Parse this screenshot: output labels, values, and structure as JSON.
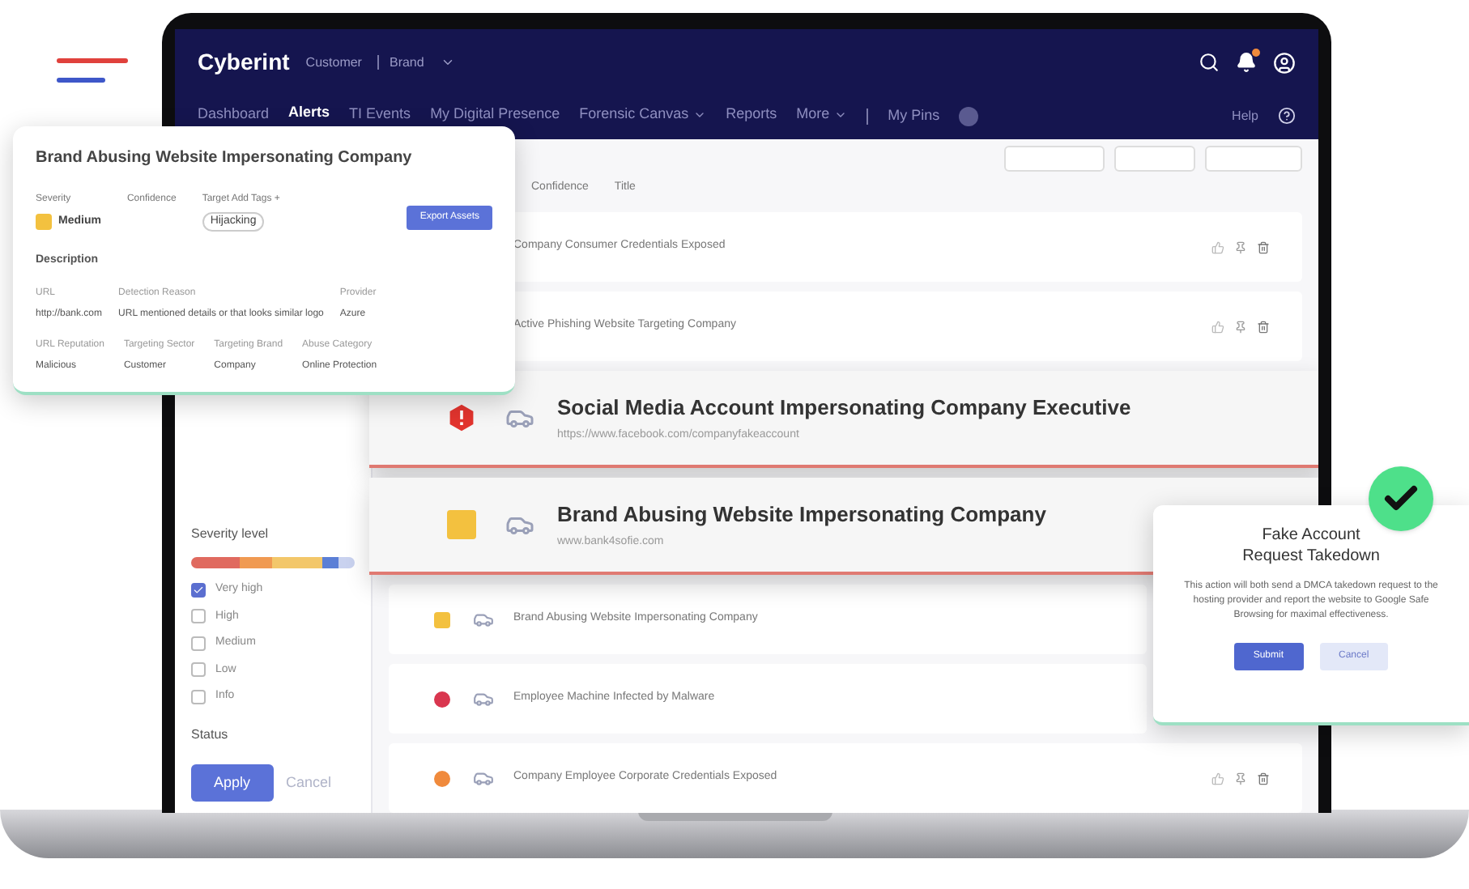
{
  "navbar": {
    "brand": "Cyberint",
    "breadcrumb": [
      "Customer",
      "Brand"
    ],
    "tabs": [
      {
        "label": "Dashboard",
        "selected": false,
        "dropdown": false
      },
      {
        "label": "Alerts",
        "selected": true,
        "dropdown": false
      },
      {
        "label": "TI Events",
        "selected": false,
        "dropdown": false
      },
      {
        "label": "My Digital Presence",
        "selected": false,
        "dropdown": false
      },
      {
        "label": "Forensic Canvas",
        "selected": false,
        "dropdown": true
      },
      {
        "label": "Reports",
        "selected": false,
        "dropdown": false
      },
      {
        "label": "More",
        "selected": false,
        "dropdown": true
      }
    ],
    "pins": "My Pins",
    "help": "Help"
  },
  "sidebar": {
    "severity_title": "Severity level",
    "levels": [
      {
        "label": "Very high",
        "checked": true
      },
      {
        "label": "High",
        "checked": false
      },
      {
        "label": "Medium",
        "checked": false
      },
      {
        "label": "Low",
        "checked": false
      },
      {
        "label": "Info",
        "checked": false
      }
    ],
    "status_title": "Status",
    "apply": "Apply",
    "cancel": "Cancel"
  },
  "list": {
    "columns": [
      "Confidence",
      "Title"
    ],
    "rows": [
      {
        "title": "Company Consumer Credentials Exposed",
        "featured": false,
        "actions": true
      },
      {
        "title": "Active Phishing Website Targeting Company",
        "featured": false,
        "actions": true
      },
      {
        "title": "Social Media Account Impersonating Company Executive",
        "featured": true,
        "kind": "critical",
        "subtitle": "https://www.facebook.com/companyfakeaccount"
      },
      {
        "title": "Brand Abusing Website Impersonating Company",
        "featured": true,
        "kind": "medium",
        "subtitle": "www.bank4sofie.com"
      },
      {
        "title": "Brand Abusing Website Impersonating Company",
        "featured": false,
        "kind": "medium"
      },
      {
        "title": "Employee Machine Infected by Malware",
        "featured": false,
        "kind": "very_high"
      },
      {
        "title": "Company Employee Corporate Credentials Exposed",
        "featured": false,
        "kind": "high",
        "actions": true
      }
    ]
  },
  "detail_card": {
    "title": "Brand Abusing Website Impersonating Company",
    "top_fields": [
      {
        "label": "Severity",
        "value": "Medium",
        "kind": "medium"
      },
      {
        "label": "Confidence"
      },
      {
        "label": "Target Add Tags +",
        "value": "Hijacking"
      }
    ],
    "button": "Export Assets",
    "section": "Description",
    "detail_fields": [
      {
        "label": "URL",
        "value": "http://bank.com"
      },
      {
        "label": "Detection Reason",
        "value": "URL mentioned details or that looks similar logo"
      },
      {
        "label": "Provider",
        "value": "Azure"
      }
    ],
    "bottom_fields": [
      {
        "label": "URL Reputation",
        "value": "Malicious"
      },
      {
        "label": "Targeting Sector",
        "value": "Customer"
      },
      {
        "label": "Targeting Brand",
        "value": "Company"
      },
      {
        "label": "Abuse Category",
        "value": "Online Protection"
      }
    ]
  },
  "modal": {
    "title": "Fake Account Request Takedown",
    "text": "This action will both send a DMCA takedown request to the hosting provider and report the website to Google Safe Browsing for maximal effectiveness.",
    "submit": "Submit",
    "cancel": "Cancel"
  }
}
